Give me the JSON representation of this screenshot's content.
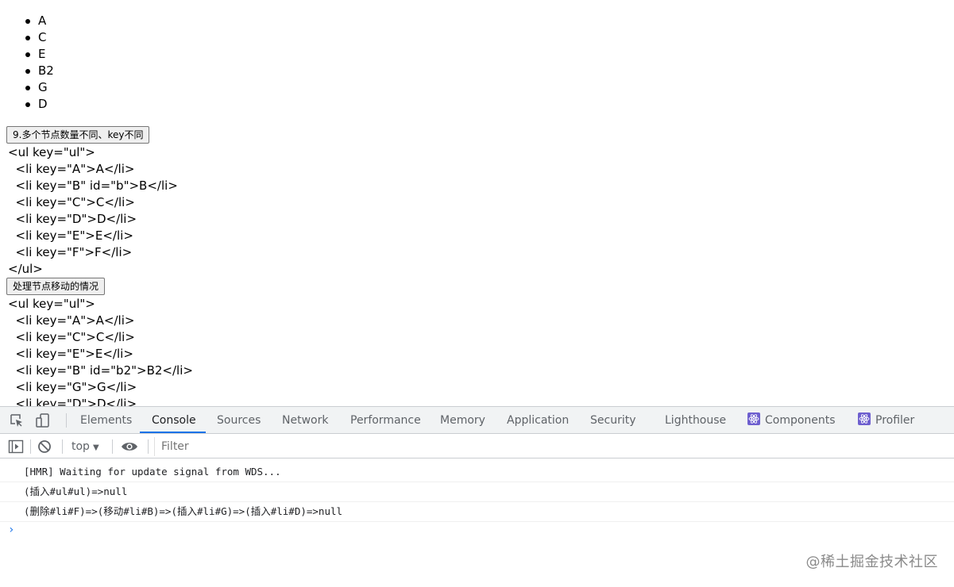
{
  "page": {
    "list_items": [
      "A",
      "C",
      "E",
      "B2",
      "G",
      "D"
    ],
    "button1_label": "9.多个节点数量不同、key不同",
    "code1": "<ul key=\"ul\">\n  <li key=\"A\">A</li>\n  <li key=\"B\" id=\"b\">B</li>\n  <li key=\"C\">C</li>\n  <li key=\"D\">D</li>\n  <li key=\"E\">E</li>\n  <li key=\"F\">F</li>\n</ul>",
    "button2_label": "处理节点移动的情况",
    "code2": "<ul key=\"ul\">\n  <li key=\"A\">A</li>\n  <li key=\"C\">C</li>\n  <li key=\"E\">E</li>\n  <li key=\"B\" id=\"b2\">B2</li>\n  <li key=\"G\">G</li>\n  <li key=\"D\">D</li>"
  },
  "devtools": {
    "tabs": [
      "Elements",
      "Console",
      "Sources",
      "Network",
      "Performance",
      "Memory",
      "Application",
      "Security",
      "Lighthouse",
      "Components",
      "Profiler"
    ],
    "active_tab": "Console",
    "context": "top",
    "filter_placeholder": "Filter",
    "accent_color": "#1a73e8",
    "react_color": "#6e5fcf",
    "messages": [
      "[HMR] Waiting for update signal from WDS...",
      "(插入#ul#ul)=>null",
      "(删除#li#F)=>(移动#li#B)=>(插入#li#G)=>(插入#li#D)=>null"
    ],
    "prompt_symbol": "›"
  },
  "watermark": "@稀土掘金技术社区"
}
